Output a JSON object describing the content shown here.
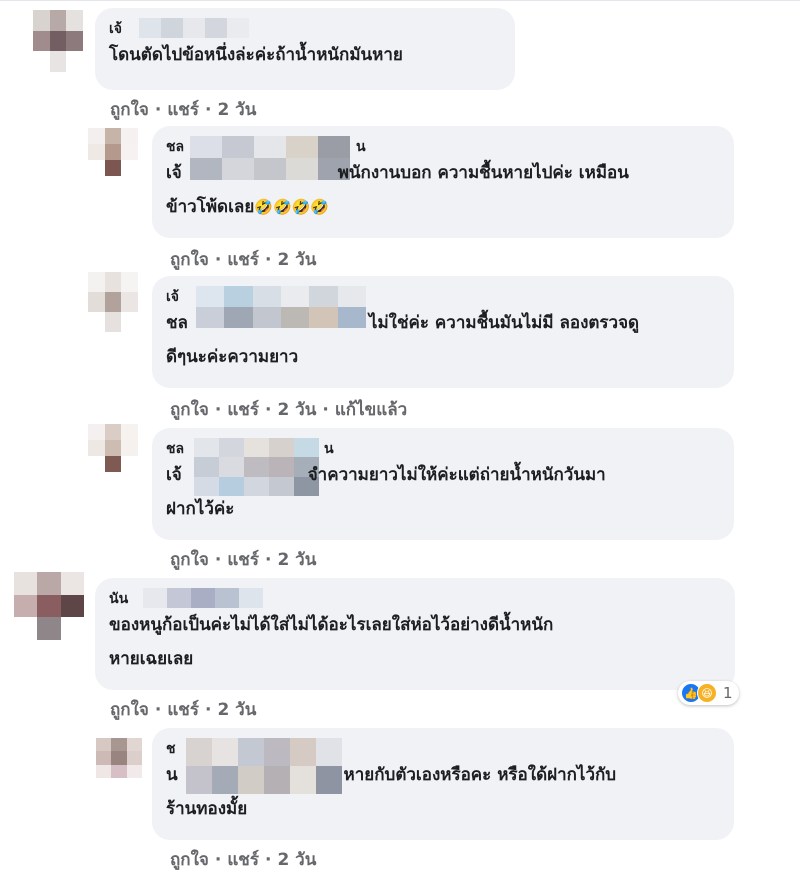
{
  "actions": {
    "like": "ถูกใจ",
    "share": "แชร์",
    "separator": "·",
    "edited": "แก้ไขแล้ว"
  },
  "comments": [
    {
      "author_visible": "เจ้",
      "text": "โดนตัดไปข้อหนึ่งล่ะค่ะถ้าน้ำหนักมันหาย",
      "time": "2 วัน"
    },
    {
      "author_visible": "ชล",
      "author_tail": "น",
      "text_prefix": "เจ้",
      "text_line1": "พนักงานบอก ความชื้นหายไปค่ะ เหมือน",
      "text_line2": "ข้าวโพ้ดเลย",
      "emoji": "🤣🤣🤣🤣",
      "time": "2 วัน"
    },
    {
      "author_visible": "เจ้",
      "text_prefix": "ชล",
      "text_line1": "ไม่ใช่ค่ะ ความชื้นมันไม่มี ลองตรวจดู",
      "text_line2": "ดีๆนะค่ะความยาว",
      "time": "2 วัน"
    },
    {
      "author_visible": "ชล",
      "author_tail": "น",
      "text_prefix": "เจ้",
      "text_line1": "จำความยาวไม่ให้ค่ะแต่ถ่ายน้ำหนักวันมา",
      "text_line2": "ฝากไว้ค่ะ",
      "time": "2 วัน"
    },
    {
      "author_visible": "นัน",
      "text_line1": "ของหนูก้อเป็นค่ะไม่ได้ใส่ไม่ได้อะไรเลยใส่ห่อไว้อย่างดีน้ำหนัก",
      "text_line2": "หายเฉยเลย",
      "reaction_count": "1",
      "reaction_icons": [
        "like-icon",
        "haha-icon"
      ],
      "time": "2 วัน"
    },
    {
      "author_visible": "ช",
      "text_prefix": "น",
      "text_line1": "หายกับตัวเองหรือคะ หรือใด้ฝากไว้กับ",
      "text_line2": "ร้านทองมั้ย",
      "time": "2 วัน"
    }
  ],
  "colors": {
    "bubble": "#f0f2f5",
    "action_text": "#65676b",
    "like_blue": "#1877f2",
    "haha_yellow": "#f7b125"
  }
}
